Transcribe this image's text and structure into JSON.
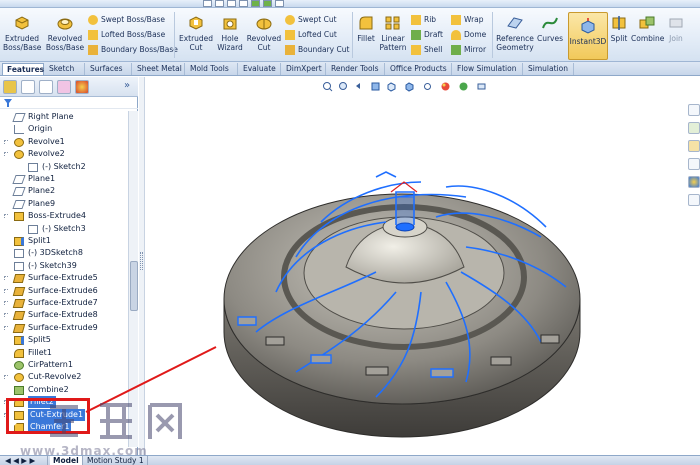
{
  "ribbon": {
    "extruded_boss": "Extruded\nBoss/Base",
    "revolved_boss": "Revolved\nBoss/Base",
    "swept_boss": "Swept Boss/Base",
    "lofted_boss": "Lofted Boss/Base",
    "boundary_boss": "Boundary Boss/Base",
    "extruded_cut": "Extruded\nCut",
    "hole_wizard": "Hole\nWizard",
    "revolved_cut": "Revolved\nCut",
    "swept_cut": "Swept Cut",
    "lofted_cut": "Lofted Cut",
    "boundary_cut": "Boundary Cut",
    "fillet": "Fillet",
    "linear_pattern": "Linear\nPattern",
    "rib": "Rib",
    "draft": "Draft",
    "shell": "Shell",
    "wrap": "Wrap",
    "dome": "Dome",
    "mirror": "Mirror",
    "reference_geometry": "Reference\nGeometry",
    "curves": "Curves",
    "instant3d": "Instant3D",
    "split": "Split",
    "combine": "Combine",
    "join": "Join"
  },
  "tabs": [
    "Features",
    "Sketch",
    "Surfaces",
    "Sheet Metal",
    "Mold Tools",
    "Evaluate",
    "DimXpert",
    "Render Tools",
    "Office Products",
    "Flow Simulation",
    "Simulation"
  ],
  "tree": [
    {
      "label": "Right Plane",
      "indent": 0,
      "icon": "plane",
      "expand": false
    },
    {
      "label": "Origin",
      "indent": 0,
      "icon": "origin",
      "expand": false
    },
    {
      "label": "Revolve1",
      "indent": 0,
      "icon": "revolve",
      "expand": true
    },
    {
      "label": "Revolve2",
      "indent": 0,
      "icon": "revolve",
      "expand": true
    },
    {
      "label": "(-) Sketch2",
      "indent": 1,
      "icon": "sketch",
      "expand": false
    },
    {
      "label": "Plane1",
      "indent": 0,
      "icon": "plane",
      "expand": false
    },
    {
      "label": "Plane2",
      "indent": 0,
      "icon": "plane",
      "expand": false
    },
    {
      "label": "Plane9",
      "indent": 0,
      "icon": "plane",
      "expand": false
    },
    {
      "label": "Boss-Extrude4",
      "indent": 0,
      "icon": "extrude",
      "expand": true
    },
    {
      "label": "(-) Sketch3",
      "indent": 1,
      "icon": "sketch",
      "expand": false
    },
    {
      "label": "Split1",
      "indent": 0,
      "icon": "split",
      "expand": false
    },
    {
      "label": "(-) 3DSketch8",
      "indent": 0,
      "icon": "sketch",
      "expand": false
    },
    {
      "label": "(-) Sketch39",
      "indent": 0,
      "icon": "sketch",
      "expand": false
    },
    {
      "label": "Surface-Extrude5",
      "indent": 0,
      "icon": "surface",
      "expand": true
    },
    {
      "label": "Surface-Extrude6",
      "indent": 0,
      "icon": "surface",
      "expand": true
    },
    {
      "label": "Surface-Extrude7",
      "indent": 0,
      "icon": "surface",
      "expand": true
    },
    {
      "label": "Surface-Extrude8",
      "indent": 0,
      "icon": "surface",
      "expand": true
    },
    {
      "label": "Surface-Extrude9",
      "indent": 0,
      "icon": "surface",
      "expand": true
    },
    {
      "label": "Split5",
      "indent": 0,
      "icon": "split",
      "expand": false
    },
    {
      "label": "Fillet1",
      "indent": 0,
      "icon": "fillet",
      "expand": false
    },
    {
      "label": "CirPattern1",
      "indent": 0,
      "icon": "pattern",
      "expand": false
    },
    {
      "label": "Cut-Revolve2",
      "indent": 0,
      "icon": "revolve",
      "expand": true
    },
    {
      "label": "Combine2",
      "indent": 0,
      "icon": "combine",
      "expand": false
    },
    {
      "label": "Fillet2",
      "indent": 0,
      "icon": "fillet",
      "expand": true,
      "selected": true
    },
    {
      "label": "Cut-Extrude1",
      "indent": 0,
      "icon": "extrude",
      "expand": true,
      "selected": true
    },
    {
      "label": "Chamfer1",
      "indent": 0,
      "icon": "chamfer",
      "expand": false,
      "selected": true
    }
  ],
  "bottom_tabs": [
    "Model",
    "Motion Study 1"
  ],
  "watermark": "www.3dmax.com",
  "colors": {
    "accent": "#3a78d9",
    "highlight_box": "#e01919",
    "edge_blue": "#1f6fff"
  }
}
